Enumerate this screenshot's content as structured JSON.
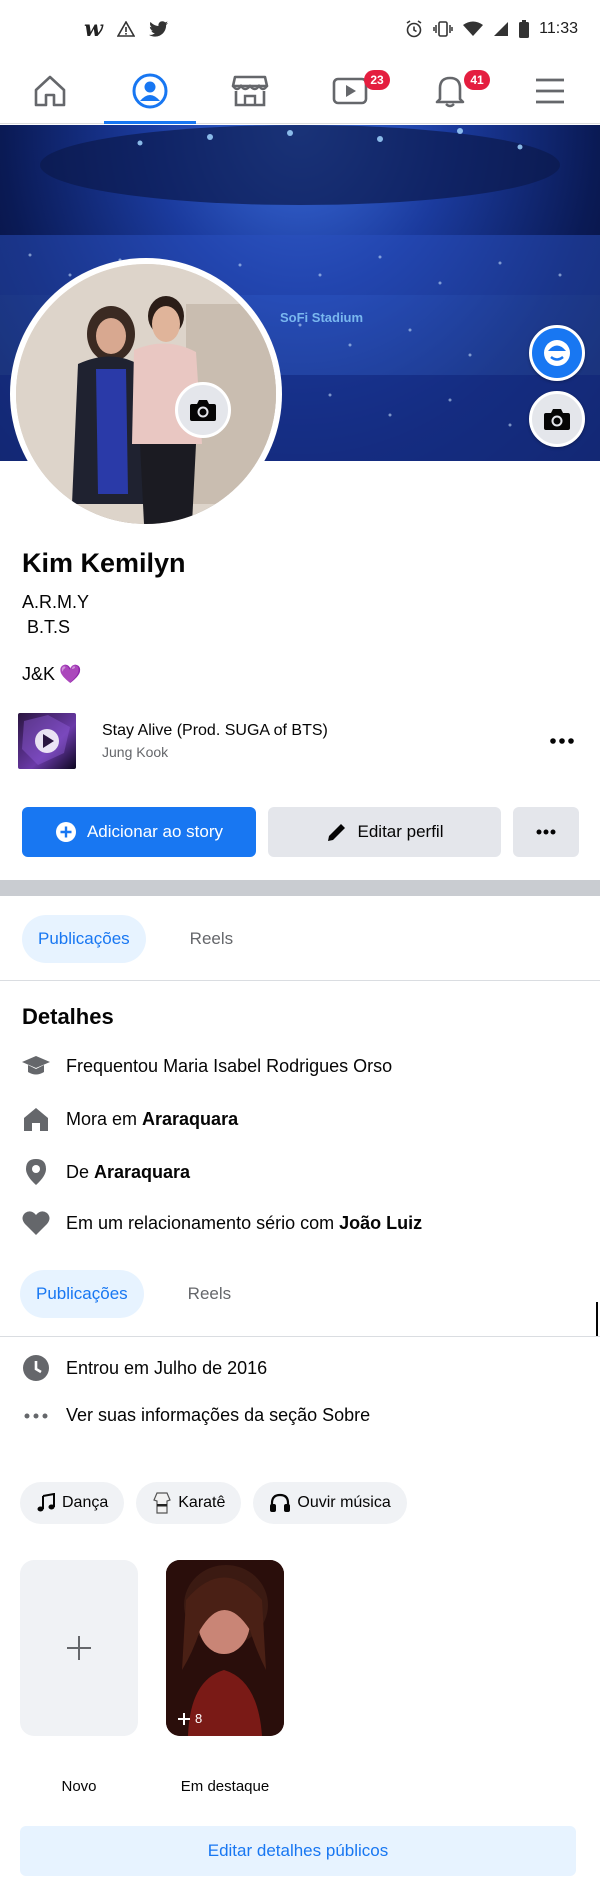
{
  "status_bar": {
    "time": "11:33",
    "w_logo": "w"
  },
  "nav": {
    "video_badge": "23",
    "notifications_badge": "41"
  },
  "cover": {
    "stadium_text": "SoFi Stadium"
  },
  "profile": {
    "name": "Kim Kemilyn",
    "bio_line1": "A.R.M.Y",
    "bio_line2": " B.T.S",
    "bio_extra": "J&K",
    "bio_emoji": "💜"
  },
  "music": {
    "song": "Stay Alive (Prod. SUGA of BTS)",
    "artist": "Jung Kook"
  },
  "actions": {
    "add_story": "Adicionar ao story",
    "edit_profile": "Editar perfil"
  },
  "tabs": {
    "posts": "Publicações",
    "reels": "Reels"
  },
  "details": {
    "title": "Detalhes",
    "studied": "Frequentou Maria Isabel Rodrigues Orso",
    "lives_prefix": "Mora em ",
    "lives_city": "Araraquara",
    "from_prefix": "De ",
    "from_city": "Araraquara",
    "relationship_prefix": "Em um relacionamento sério com ",
    "relationship_partner": "João Luiz",
    "joined": "Entrou em Julho de 2016",
    "see_about": "Ver suas informações da seção Sobre"
  },
  "hobbies": [
    "Dança",
    "Karatê",
    "Ouvir música"
  ],
  "featured": {
    "new_label": "Novo",
    "highlight_label": "Em destaque",
    "highlight_count": "8"
  },
  "edit_public_details": "Editar detalhes públicos",
  "colors": {
    "accent": "#1877f2",
    "badge": "#e41e3f",
    "secondary_button": "#e4e6eb"
  }
}
